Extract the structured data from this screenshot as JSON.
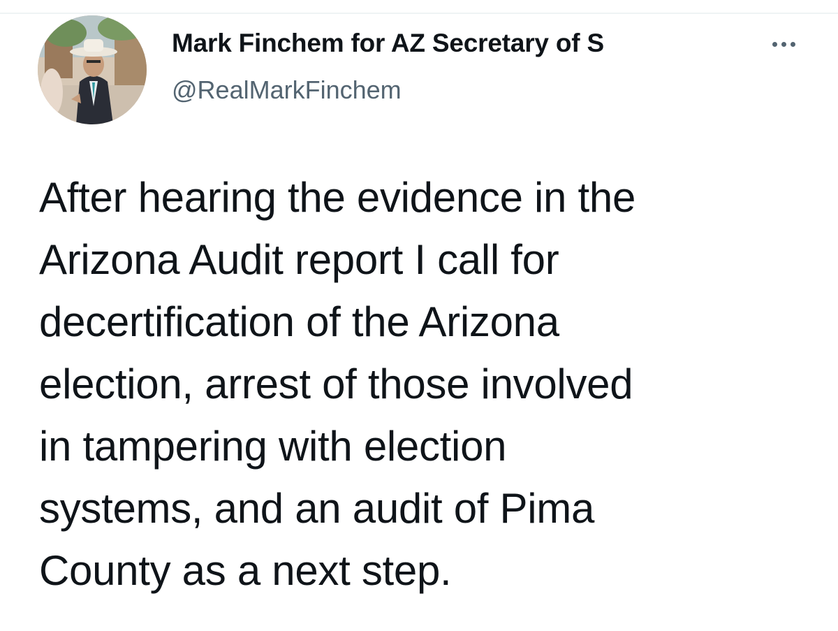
{
  "tweet": {
    "author": {
      "display_name": "Mark Finchem for AZ Secretary of S",
      "handle": "@RealMarkFinchem",
      "avatar_icon": "profile-photo"
    },
    "more_icon": "more-options-icon",
    "text": "After hearing the evidence in the\nArizona Audit report I call for\ndecertification of the Arizona\nelection, arrest of those involved\nin tampering with election\nsystems, and an audit of Pima\nCounty as a next step."
  },
  "colors": {
    "text_primary": "#0f1419",
    "text_secondary": "#536471",
    "divider": "#eff3f4",
    "background": "#ffffff"
  }
}
